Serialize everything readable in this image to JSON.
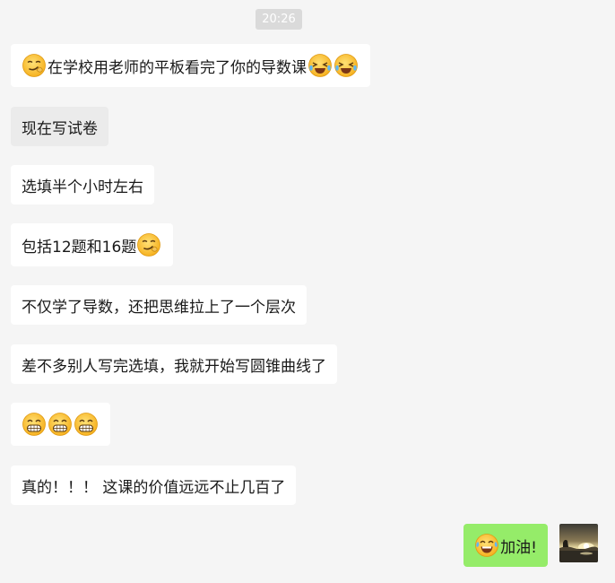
{
  "chat": {
    "timestamp": "20:26",
    "messages": [
      {
        "text": "在学校用老师的平板看完了你的导数课",
        "emoji_before": "smirk-icon",
        "emoji_after": [
          "laugh-cry-icon",
          "laugh-cry-icon"
        ]
      },
      {
        "text": "现在写试卷"
      },
      {
        "text": "选填半个小时左右"
      },
      {
        "text": "包括12题和16题",
        "emoji_after": [
          "smirk-icon"
        ]
      },
      {
        "text": "不仅学了导数，还把思维拉上了一个层次"
      },
      {
        "text": "差不多别人写完选填，我就开始写圆锥曲线了"
      },
      {
        "emoji_only": [
          "grin-icon",
          "grin-icon",
          "grin-icon"
        ]
      },
      {
        "text": "真的！！！ 这课的价值远远不止几百了"
      }
    ],
    "my_reply": {
      "text": "加油!",
      "emoji_before": "tears-of-joy-icon"
    }
  },
  "colors": {
    "background": "#f5f5f5",
    "incoming_bubble": "#ffffff",
    "highlight_bubble": "#ebebeb",
    "outgoing_bubble": "#95ec69",
    "timestamp_bg": "#dadada"
  }
}
